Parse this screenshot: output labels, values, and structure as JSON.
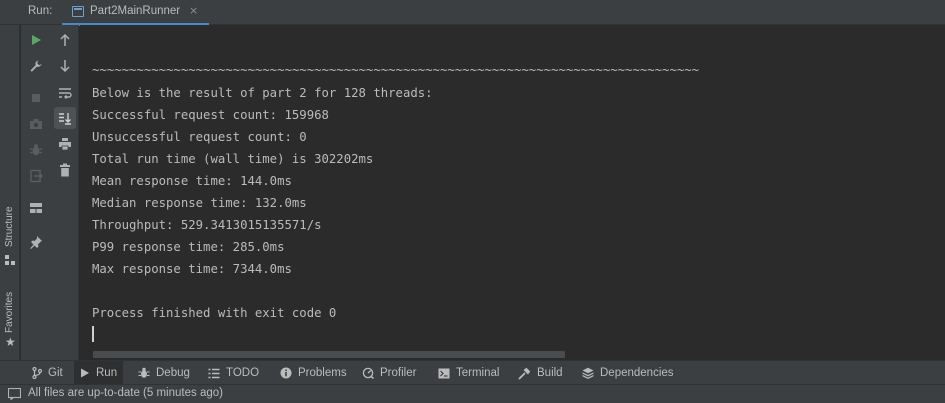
{
  "run_header": {
    "label": "Run:",
    "tab_title": "Part2MainRunner",
    "tab_close": "×"
  },
  "edge_stripe": {
    "structure_label": "Structure",
    "favorites_label": "Favorites"
  },
  "toolbar": {
    "left_column": [
      "rerun-icon",
      "wrench-icon",
      "stop-icon",
      "camera-icon",
      "debug-bug-icon",
      "exit-icon",
      "layout-icon",
      "pin-icon"
    ],
    "right_column": [
      "arrow-up-icon",
      "arrow-down-icon",
      "soft-wrap-icon",
      "scroll-to-end-icon",
      "print-icon",
      "trash-icon"
    ]
  },
  "console": {
    "lines": [
      "~~~~~~~~~~~~~~~~~~~~~~~~~~~~~~~~~~~~~~~~~~~~~~~~~~~~~~~~~~~~~~~~~~~~~~~~~~~~~~~~~~",
      "Below is the result of part 2 for 128 threads:",
      "Successful request count: 159968",
      "Unsuccessful request count: 0",
      "Total run time (wall time) is 302202ms",
      "Mean response time: 144.0ms",
      "Median response time: 132.0ms",
      "Throughput: 529.3413015135571/s",
      "P99 response time: 285.0ms",
      "Max response time: 7344.0ms",
      "",
      "Process finished with exit code 0"
    ]
  },
  "bottom_tabs": [
    {
      "label": "Git",
      "icon": "git-branch-icon"
    },
    {
      "label": "Run",
      "icon": "run-play-icon",
      "active": true
    },
    {
      "label": "Debug",
      "icon": "debug-bug-icon"
    },
    {
      "label": "TODO",
      "icon": "todo-list-icon"
    },
    {
      "label": "Problems",
      "icon": "problems-info-icon"
    },
    {
      "label": "Profiler",
      "icon": "profiler-gauge-icon"
    },
    {
      "label": "Terminal",
      "icon": "terminal-icon"
    },
    {
      "label": "Build",
      "icon": "build-hammer-icon"
    },
    {
      "label": "Dependencies",
      "icon": "dependencies-stack-icon"
    }
  ],
  "status_bar": {
    "text": "All files are up-to-date (5 minutes ago)"
  },
  "colors": {
    "panel": "#3c3f41",
    "console_bg": "#2b2b2b",
    "text": "#bbbbbb",
    "accent": "#4a88c7",
    "run_green": "#59a869"
  }
}
